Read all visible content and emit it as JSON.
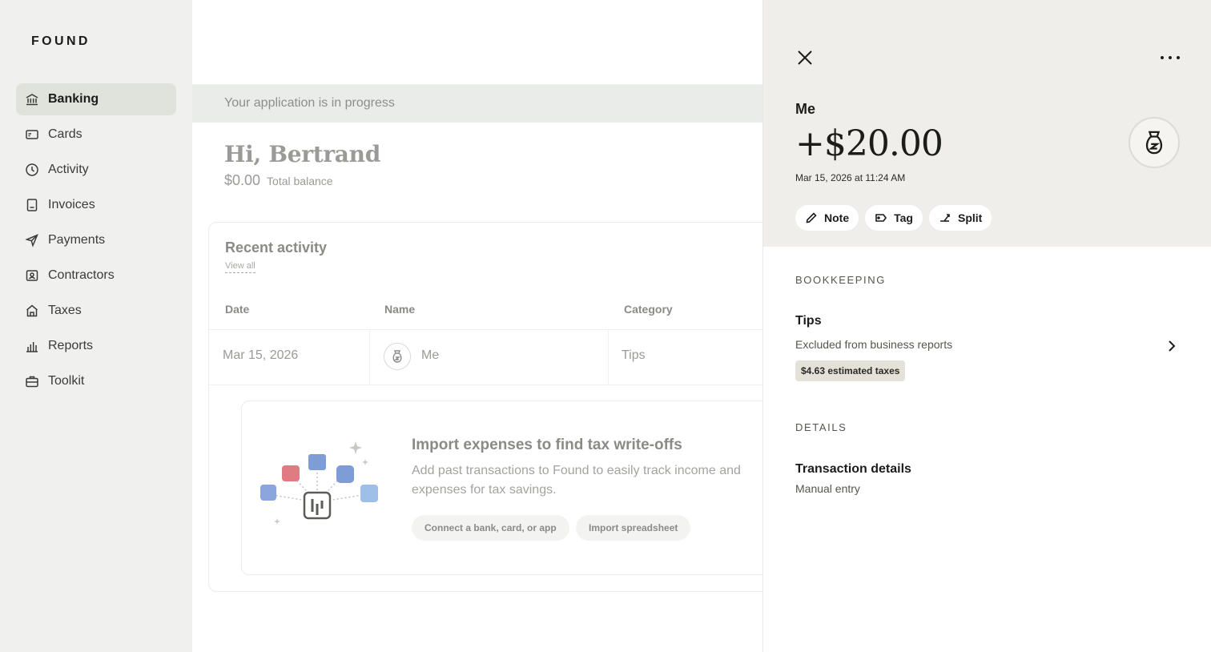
{
  "brand": "FOUND",
  "sidebar": {
    "items": [
      {
        "label": "Banking",
        "icon": "bank-icon",
        "active": true
      },
      {
        "label": "Cards",
        "icon": "card-icon"
      },
      {
        "label": "Activity",
        "icon": "clock-icon"
      },
      {
        "label": "Invoices",
        "icon": "invoice-icon"
      },
      {
        "label": "Payments",
        "icon": "send-icon"
      },
      {
        "label": "Contractors",
        "icon": "contractor-icon"
      },
      {
        "label": "Taxes",
        "icon": "government-icon"
      },
      {
        "label": "Reports",
        "icon": "bar-chart-icon"
      },
      {
        "label": "Toolkit",
        "icon": "toolbox-icon"
      }
    ]
  },
  "main": {
    "banner": "Your application is in progress",
    "greeting": "Hi, Bertrand",
    "balance": "$0.00",
    "balance_label": "Total balance",
    "recent": {
      "title": "Recent activity",
      "view_all": "View all",
      "columns": [
        "Date",
        "Name",
        "Category"
      ],
      "rows": [
        {
          "date": "Mar 15, 2026",
          "name": "Me",
          "category": "Tips"
        }
      ]
    },
    "promo": {
      "title": "Import expenses to find tax write-offs",
      "text": "Add past transactions to Found to easily track income and expenses for tax savings.",
      "connect_button": "Connect a bank, card, or app",
      "import_button": "Import spreadsheet"
    }
  },
  "drawer": {
    "payee": "Me",
    "amount": "+$20.00",
    "datetime": "Mar 15, 2026 at 11:24 AM",
    "actions": [
      {
        "label": "Note",
        "icon": "pencil-icon"
      },
      {
        "label": "Tag",
        "icon": "tag-icon"
      },
      {
        "label": "Split",
        "icon": "split-icon"
      }
    ],
    "bookkeeping": {
      "section": "BOOKKEEPING",
      "category": "Tips",
      "subtitle": "Excluded from business reports",
      "tax_badge": "$4.63 estimated taxes"
    },
    "details": {
      "section": "DETAILS",
      "title": "Transaction details",
      "subtitle": "Manual entry"
    }
  },
  "colors": {
    "sidebar_bg": "#f0f0ee",
    "active_item_bg": "#dfe3dc",
    "drawer_header_bg": "#efeeea",
    "tax_badge_bg": "#e4e1d8"
  }
}
